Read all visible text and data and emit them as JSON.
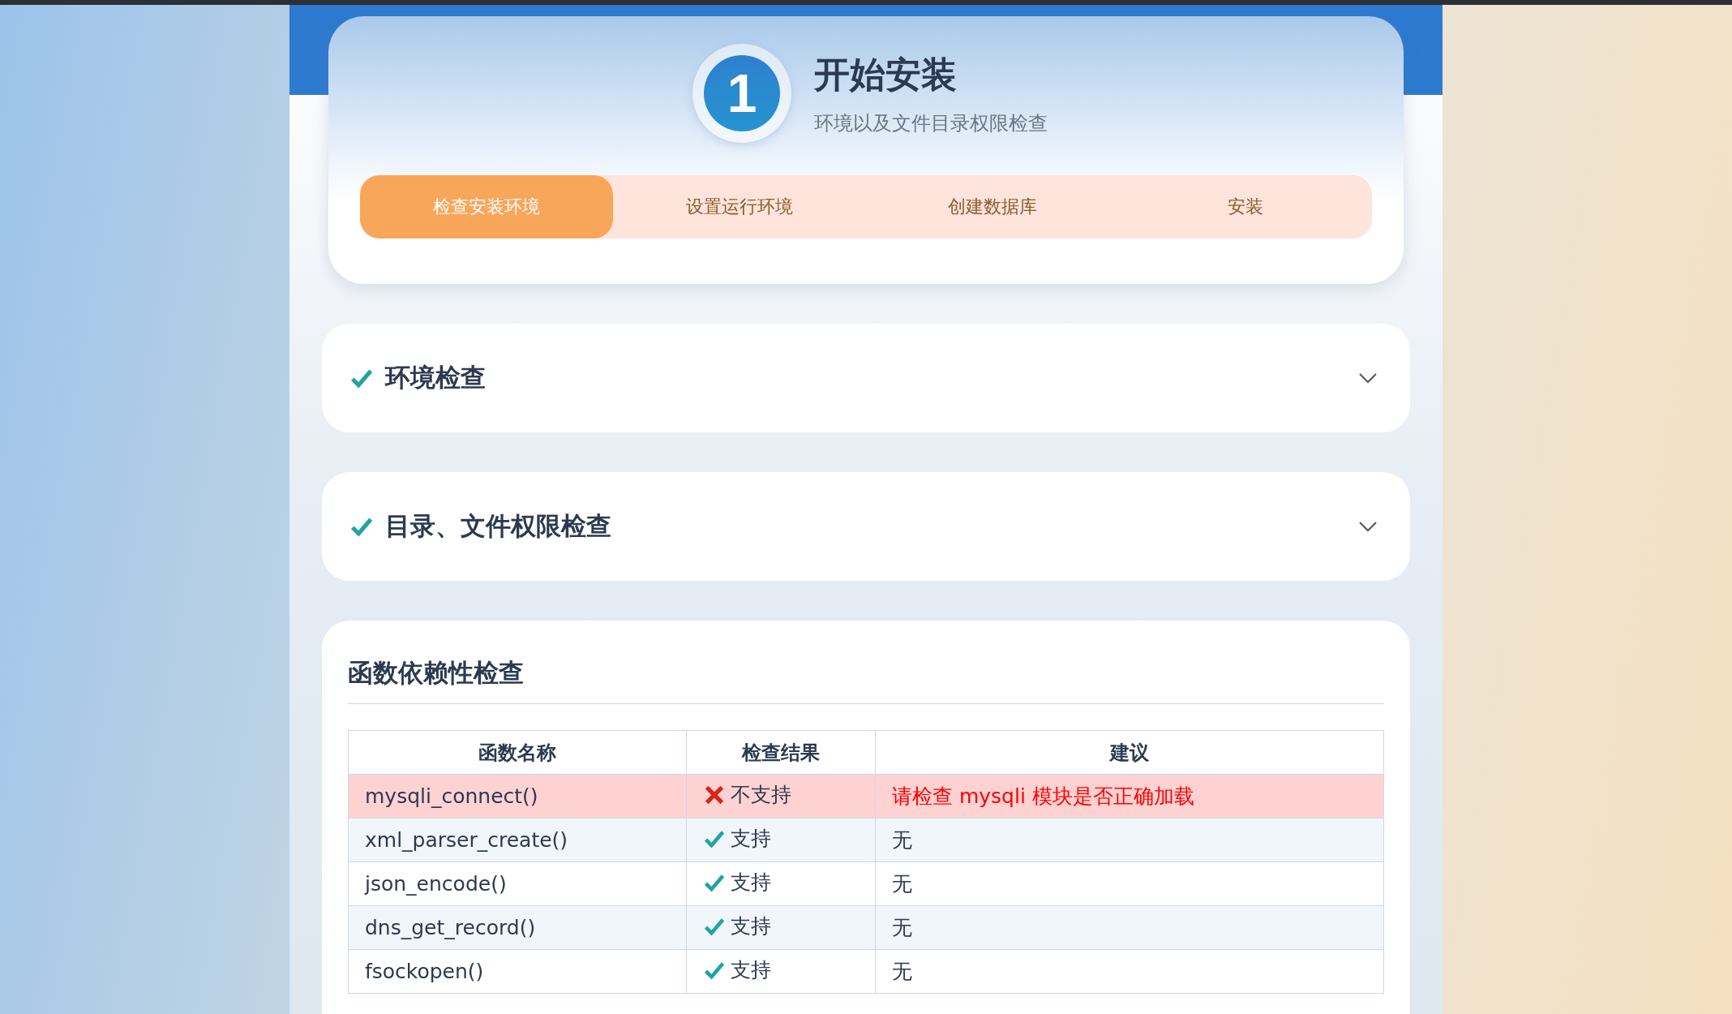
{
  "header": {
    "step": "1",
    "title": "开始安装",
    "subtitle": "环境以及文件目录权限检查"
  },
  "steps": [
    {
      "label": "检查安装环境",
      "selected": true
    },
    {
      "label": "设置运行环境",
      "selected": false
    },
    {
      "label": "创建数据库",
      "selected": false
    },
    {
      "label": "安装",
      "selected": false
    }
  ],
  "sections": [
    {
      "title": "环境检查",
      "passed": true,
      "expanded": false
    },
    {
      "title": "目录、文件权限检查",
      "passed": true,
      "expanded": false
    }
  ],
  "function_check": {
    "title": "函数依赖性检查",
    "columns": [
      "函数名称",
      "检查结果",
      "建议"
    ],
    "rows": [
      {
        "name": "mysqli_connect()",
        "ok": false,
        "result": "不支持",
        "advice": "请检查 mysqli 模块是否正确加载"
      },
      {
        "name": "xml_parser_create()",
        "ok": true,
        "result": "支持",
        "advice": "无"
      },
      {
        "name": "json_encode()",
        "ok": true,
        "result": "支持",
        "advice": "无"
      },
      {
        "name": "dns_get_record()",
        "ok": true,
        "result": "支持",
        "advice": "无"
      },
      {
        "name": "fsockopen()",
        "ok": true,
        "result": "支持",
        "advice": "无"
      }
    ]
  }
}
